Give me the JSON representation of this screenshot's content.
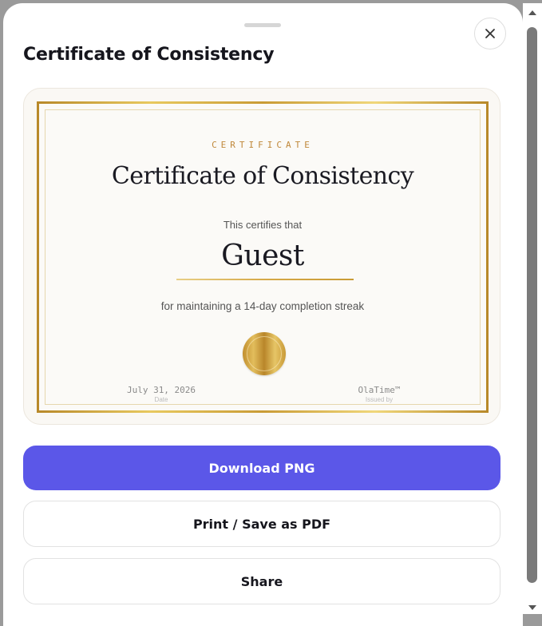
{
  "sheet": {
    "title": "Certificate of Consistency",
    "close_icon": "close-icon"
  },
  "certificate": {
    "eyebrow": "CERTIFICATE",
    "title": "Certificate of Consistency",
    "certifies": "This certifies that",
    "recipient": "Guest",
    "reason": "for maintaining a 14-day completion streak",
    "date_value": "July 31, 2026",
    "date_label": "Date",
    "issuer_value": "OlaTime™",
    "issuer_label": "Issued by",
    "seal_icon": "gold-seal-icon"
  },
  "actions": {
    "download": "Download PNG",
    "print": "Print / Save as PDF",
    "share": "Share"
  },
  "colors": {
    "accent": "#5b57e8",
    "gold": "#c9a13b",
    "eyebrow": "#c0883a"
  }
}
